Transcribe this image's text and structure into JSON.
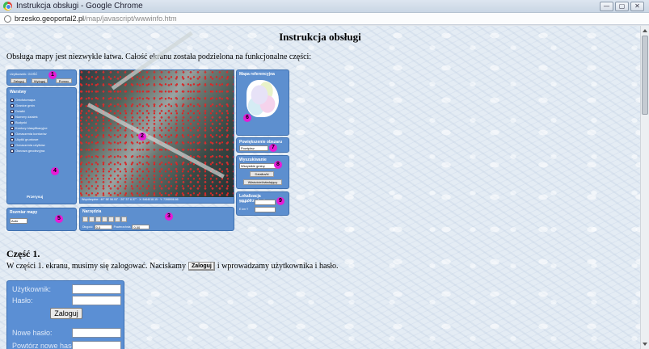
{
  "window": {
    "title": "Instrukcja obsługi - Google Chrome",
    "buttons": {
      "minimize": "—",
      "maximize": "▢",
      "close": "✕"
    }
  },
  "address": {
    "host": "brzesko.geoportal2.pl",
    "path": "/map/javascript/wwwinfo.htm"
  },
  "page": {
    "heading": "Instrukcja obsługi",
    "intro": "Obsługa mapy jest niezwykle łatwa. Całość ekranu została podzielona na funkcjonalne części:",
    "part1_heading": "Część 1.",
    "part1_text_before": "W części 1. ekranu, musimy się zalogować. Naciskamy",
    "part1_button": "Zaloguj",
    "part1_text_after": "i wprowadzamy użytkownika i hasło."
  },
  "mini": {
    "login": {
      "user_label": "Użytkownik:",
      "user_value": "GOŚĆ",
      "btn_login": "Zaloguj",
      "btn_logout": "Wyloguj",
      "btn_help": "Pomoc"
    },
    "layers": {
      "header": "Warstwy",
      "items": [
        "Ortofotomapa",
        "Granice gmin",
        "Działki",
        "Numery działek",
        "Budynki",
        "Kontury klasyfikacyjne",
        "Oznaczenia konturów",
        "Użytki gruntowe",
        "Oznaczenia użytków",
        "Osnowa geodezyjna"
      ]
    },
    "refresh": "Przerysuj",
    "coords": "Współrzędne : 49° 58' 56.93\"  ·  20° 37' 6.37\"  ·  X: 5464018.15  ·  Y: 7398906.66",
    "scale_header": "Rozmiar mapy",
    "scale_value": "Auto",
    "tools_header": "Narzędzia",
    "tools_fields": {
      "length_label": "Długość",
      "length_value": "0,0",
      "area_label": "Powierzchnia",
      "area_value": "0,00"
    },
    "ref_map_header": "Mapa referencyjna",
    "zoom_header": "Powiększenie obszaru",
    "zoom_value": "Powiększ",
    "search_header": "Wyszukiwanie",
    "search_select": "Wszystkie gminy",
    "search_btn1": "Działka/ki",
    "search_btn2": "Właściciel/władający",
    "locate_header": "Lokalizacja współrzędnej",
    "locate_x": "X km Y",
    "locate_y": "E km Y",
    "badges": [
      "1",
      "2",
      "3",
      "4",
      "5",
      "6",
      "7",
      "8",
      "9"
    ]
  },
  "loginpanel": {
    "user_label": "Użytkownik:",
    "password_label": "Hasło:",
    "login_button": "Zaloguj",
    "new_password_label": "Nowe hasło:",
    "repeat_label": "Powtórz nowe hasło:"
  },
  "colors": {
    "panel": "#5d8fcf",
    "badge": "#e61cd6"
  }
}
